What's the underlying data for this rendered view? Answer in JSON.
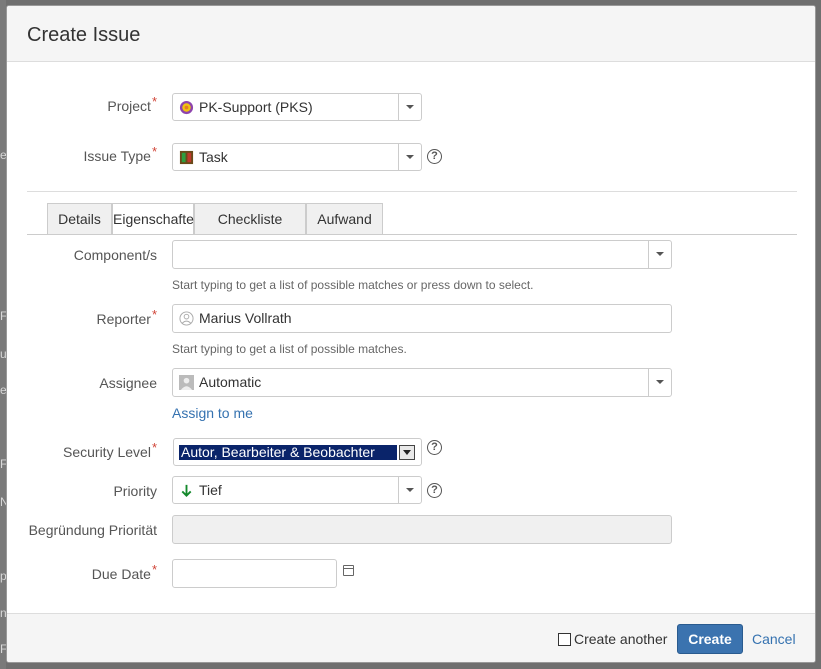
{
  "dialog": {
    "title": "Create Issue"
  },
  "background": {
    "letters": [
      "e",
      "F",
      "u",
      "e",
      "F",
      "N",
      "p",
      "n",
      "F"
    ]
  },
  "project": {
    "label": "Project",
    "value": "PK-Support (PKS)",
    "icon": "project-avatar-icon"
  },
  "issue_type": {
    "label": "Issue Type",
    "value": "Task",
    "icon": "task-icon",
    "help": "?"
  },
  "tabs": [
    {
      "label": "Details",
      "active": false
    },
    {
      "label": "Eigenschaften",
      "active": true
    },
    {
      "label": "Checkliste",
      "active": false
    },
    {
      "label": "Aufwand",
      "active": false
    }
  ],
  "components": {
    "label": "Component/s",
    "value": "",
    "hint": "Start typing to get a list of possible matches or press down to select."
  },
  "reporter": {
    "label": "Reporter",
    "value": "Marius Vollrath",
    "hint": "Start typing to get a list of possible matches."
  },
  "assignee": {
    "label": "Assignee",
    "value": "Automatic",
    "assign_to_me": "Assign to me"
  },
  "security_level": {
    "label": "Security Level",
    "value": "Autor, Bearbeiter & Beobachter",
    "help": "?"
  },
  "priority": {
    "label": "Priority",
    "value": "Tief",
    "help": "?",
    "arrow_color": "#14892c"
  },
  "priority_reason": {
    "label": "Begründung Priorität",
    "value": ""
  },
  "due_date": {
    "label": "Due Date",
    "value": ""
  },
  "required_marker": "*",
  "footer": {
    "create_another": "Create another",
    "create": "Create",
    "cancel": "Cancel"
  },
  "colors": {
    "primary": "#3b73af",
    "link": "#3572b0",
    "required": "#d04437"
  }
}
